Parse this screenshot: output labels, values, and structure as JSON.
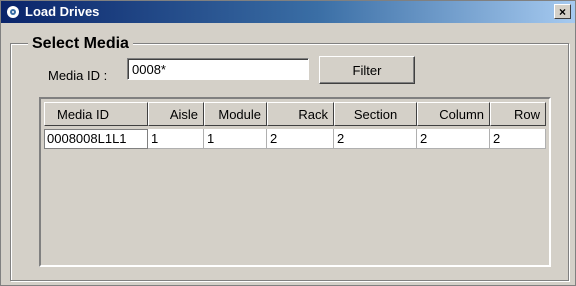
{
  "window": {
    "title": "Load Drives",
    "close_glyph": "×"
  },
  "select_media": {
    "legend": "Select Media",
    "media_id_label": "Media ID :",
    "media_id_value": "0008*",
    "filter_label": "Filter"
  },
  "table": {
    "columns": [
      "Media ID",
      "Aisle",
      "Module",
      "Rack",
      "Section",
      "Column",
      "Row"
    ],
    "rows": [
      [
        "0008008L1L1",
        "1",
        "1",
        "2",
        "2",
        "2",
        "2"
      ]
    ]
  }
}
